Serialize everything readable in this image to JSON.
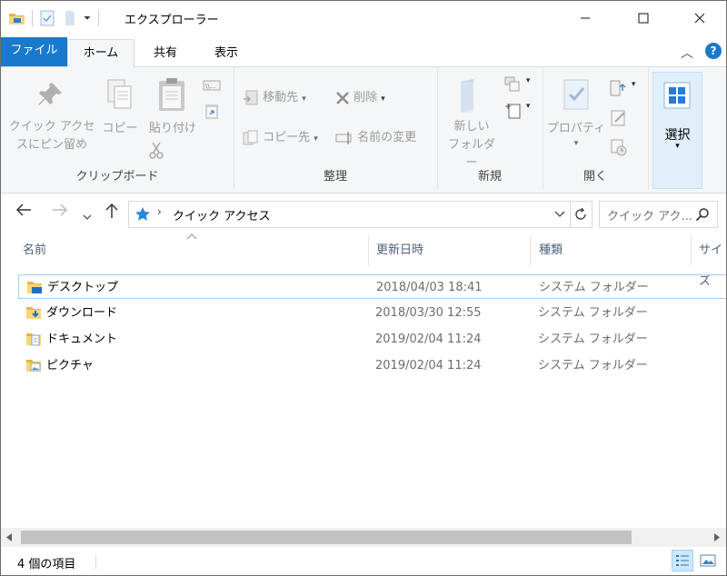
{
  "window": {
    "title": "エクスプローラー",
    "minimize": "—",
    "maximize": "☐",
    "close": "✕"
  },
  "tabs": {
    "file": "ファイル",
    "home": "ホーム",
    "share": "共有",
    "view": "表示"
  },
  "ribbon": {
    "clipboard": {
      "pin_line1": "クイック アクセ",
      "pin_line2": "スにピン留め",
      "copy": "コピー",
      "paste": "貼り付け",
      "label": "クリップボード"
    },
    "organize": {
      "move_to": "移動先",
      "copy_to": "コピー先",
      "delete": "削除",
      "rename": "名前の変更",
      "label": "整理"
    },
    "new": {
      "new_folder_line1": "新しい",
      "new_folder_line2": "フォルダー",
      "label": "新規"
    },
    "open": {
      "properties": "プロパティ",
      "label": "開く"
    },
    "select": {
      "select": "選択"
    }
  },
  "nav": {
    "address_text": "クイック アクセス",
    "search_placeholder": "クイック アク..."
  },
  "columns": {
    "name": "名前",
    "modified": "更新日時",
    "type": "種類",
    "size": "サイズ"
  },
  "files": [
    {
      "name": "デスクトップ",
      "modified": "2018/04/03 18:41",
      "type": "システム フォルダー",
      "icon": "desktop-folder-icon"
    },
    {
      "name": "ダウンロード",
      "modified": "2018/03/30 12:55",
      "type": "システム フォルダー",
      "icon": "downloads-folder-icon"
    },
    {
      "name": "ドキュメント",
      "modified": "2019/02/04 11:24",
      "type": "システム フォルダー",
      "icon": "documents-folder-icon"
    },
    {
      "name": "ピクチャ",
      "modified": "2019/02/04 11:24",
      "type": "システム フォルダー",
      "icon": "pictures-folder-icon"
    }
  ],
  "status": {
    "item_count": "4 個の項目"
  },
  "colors": {
    "accent": "#1979ca",
    "ribbon_bg": "#f5f6f7",
    "selection_border": "#99d1ff",
    "select_button_bg": "#e1effa"
  }
}
